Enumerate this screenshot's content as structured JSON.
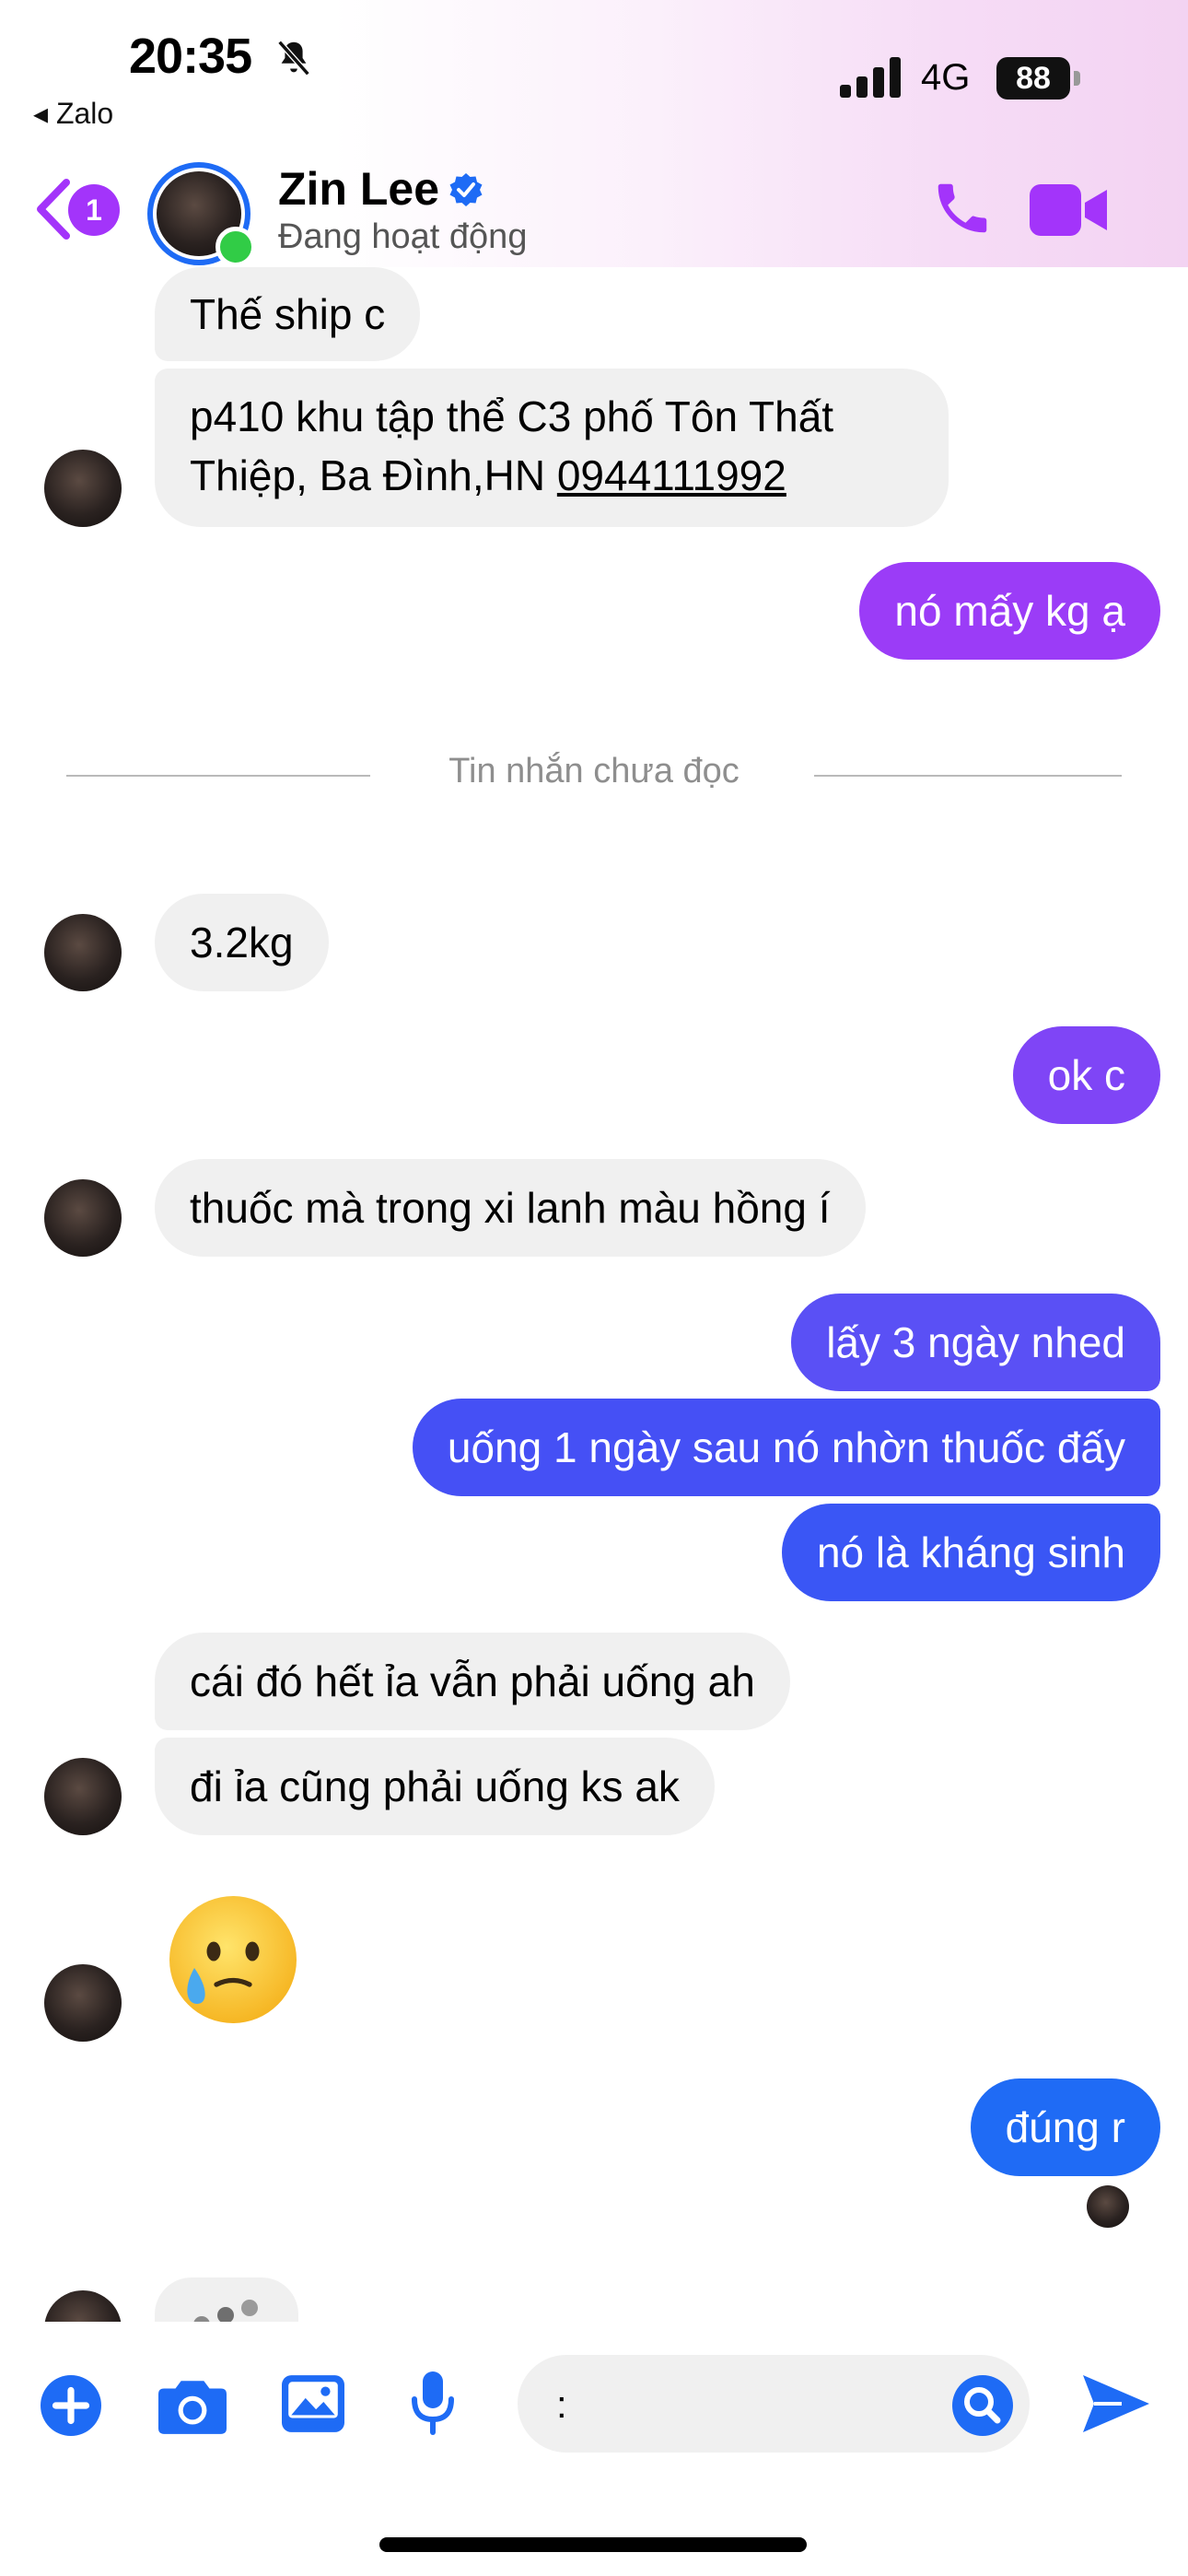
{
  "status_bar": {
    "time": "20:35",
    "back_app": "◂ Zalo",
    "network": "4G",
    "battery": "88"
  },
  "header": {
    "unread_count": "1",
    "contact_name": "Zin Lee",
    "contact_status": "Đang hoạt động",
    "accent_color": "#a334fa"
  },
  "messages": {
    "m1": "Thế ship c",
    "m2_line1": "p410 khu tập thể C3 phố Tôn Thất",
    "m2_line2_prefix": "Thiệp, Ba Đình,HN ",
    "m2_phone": "0944111992",
    "m3": "nó mấy kg ạ",
    "unread_divider": "Tin nhắn chưa đọc",
    "m4": "3.2kg",
    "m5": "ok c",
    "m6": "thuốc mà trong xi lanh màu hồng í",
    "m7": "lấy 3 ngày nhed",
    "m8": "uống 1 ngày sau nó nhờn thuốc đấy",
    "m9": "nó là kháng sinh",
    "m10": "cái đó hết ỉa vẫn phải uống ah",
    "m11": "đi ỉa cũng phải uống ks ak",
    "m12_emoji": "face-holding-back-tears",
    "m13": "đúng r"
  },
  "composer": {
    "input_value": ":"
  },
  "colors": {
    "outgoing_purple": "#9b3cf7",
    "outgoing_blue": "#3b56f5",
    "incoming": "#f0f0f0"
  }
}
